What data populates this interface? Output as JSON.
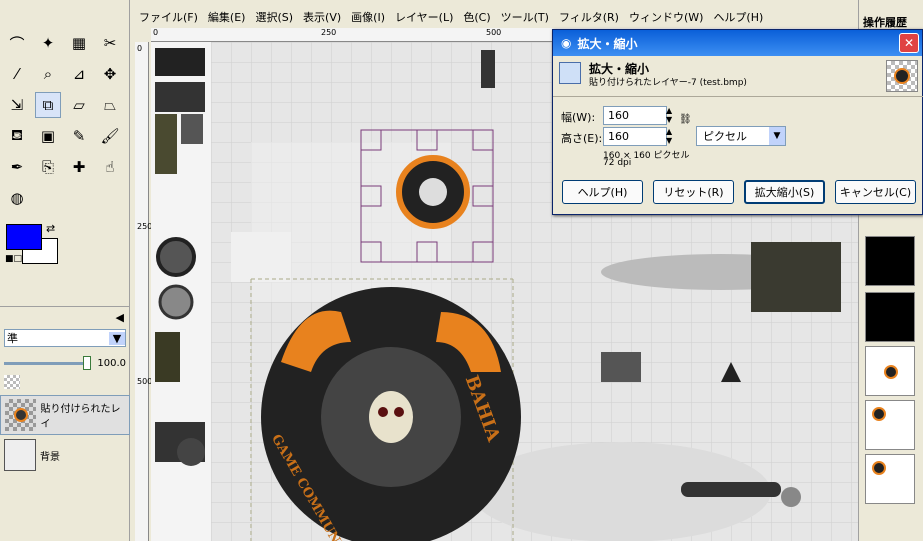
{
  "menu": [
    "ファイル(F)",
    "編集(E)",
    "選択(S)",
    "表示(V)",
    "画像(I)",
    "レイヤー(L)",
    "色(C)",
    "ツール(T)",
    "フィルタ(R)",
    "ウィンドウ(W)",
    "ヘルプ(H)"
  ],
  "ruler": {
    "h": [
      "0",
      "250",
      "500"
    ],
    "v": [
      "0",
      "250",
      "500"
    ]
  },
  "tools": [
    "lasso-icon",
    "fuzzy-select-icon",
    "color-select-icon",
    "scissors-icon",
    "color-picker-icon",
    "zoom-icon",
    "measure-icon",
    "move-icon",
    "align-icon",
    "scale-icon",
    "shear-icon",
    "perspective-icon",
    "bucket-fill-icon",
    "blend-icon",
    "pencil-icon",
    "paintbrush-icon",
    "ink-icon",
    "clone-icon",
    "heal-icon",
    "smudge-icon",
    "airbrush-icon"
  ],
  "colors": {
    "fg": "#0000ff",
    "bg": "#ffffff",
    "accent": "#e8821e"
  },
  "layers_panel": {
    "mode_label": "準",
    "opacity": "100.0",
    "layers": [
      {
        "name": "貼り付けられたレイ"
      },
      {
        "name": "背景"
      }
    ]
  },
  "right_dock": {
    "title": "操作履歴"
  },
  "dialog": {
    "title": "拡大・縮小",
    "heading": "拡大・縮小",
    "subtitle": "貼り付けられたレイヤー-7 (test.bmp)",
    "width_label": "幅(W):",
    "width_value": "160",
    "height_label": "高さ(E):",
    "height_value": "160",
    "unit": "ピクセル",
    "info_size": "160 × 160 ピクセル",
    "info_dpi": "72 dpi",
    "buttons": [
      "ヘルプ(H)",
      "リセット(R)",
      "拡大縮小(S)",
      "キャンセル(C)"
    ]
  },
  "emblem": {
    "top_text": "BAHIA",
    "left_text": "GAME COMMUNITY"
  }
}
